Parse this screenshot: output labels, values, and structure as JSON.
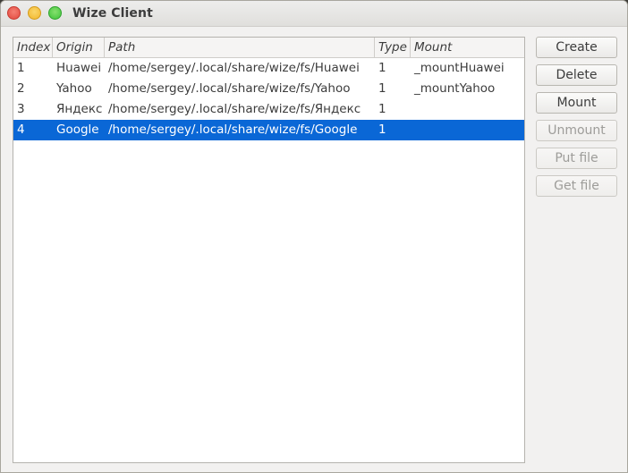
{
  "window": {
    "title": "Wize Client"
  },
  "table": {
    "headers": {
      "index": "Index",
      "origin": "Origin",
      "path": "Path",
      "type": "Type",
      "mount": "Mount"
    },
    "rows": [
      {
        "index": "1",
        "origin": "Huawei",
        "path": "/home/sergey/.local/share/wize/fs/Huawei",
        "type": "1",
        "mount": "_mountHuawei"
      },
      {
        "index": "2",
        "origin": "Yahoo",
        "path": "/home/sergey/.local/share/wize/fs/Yahoo",
        "type": "1",
        "mount": "_mountYahoo"
      },
      {
        "index": "3",
        "origin": "Яндекс",
        "path": "/home/sergey/.local/share/wize/fs/Яндекс",
        "type": "1",
        "mount": ""
      },
      {
        "index": "4",
        "origin": "Google",
        "path": "/home/sergey/.local/share/wize/fs/Google",
        "type": "1",
        "mount": ""
      }
    ],
    "selected_row": "4"
  },
  "buttons": {
    "create": "Create",
    "delete": "Delete",
    "mount": "Mount",
    "unmount": "Unmount",
    "put_file": "Put file",
    "get_file": "Get file"
  },
  "colors": {
    "selection": "#0a67d6",
    "close": "#e2483d",
    "minimize": "#f2b62b",
    "maximize": "#3fc43a"
  }
}
